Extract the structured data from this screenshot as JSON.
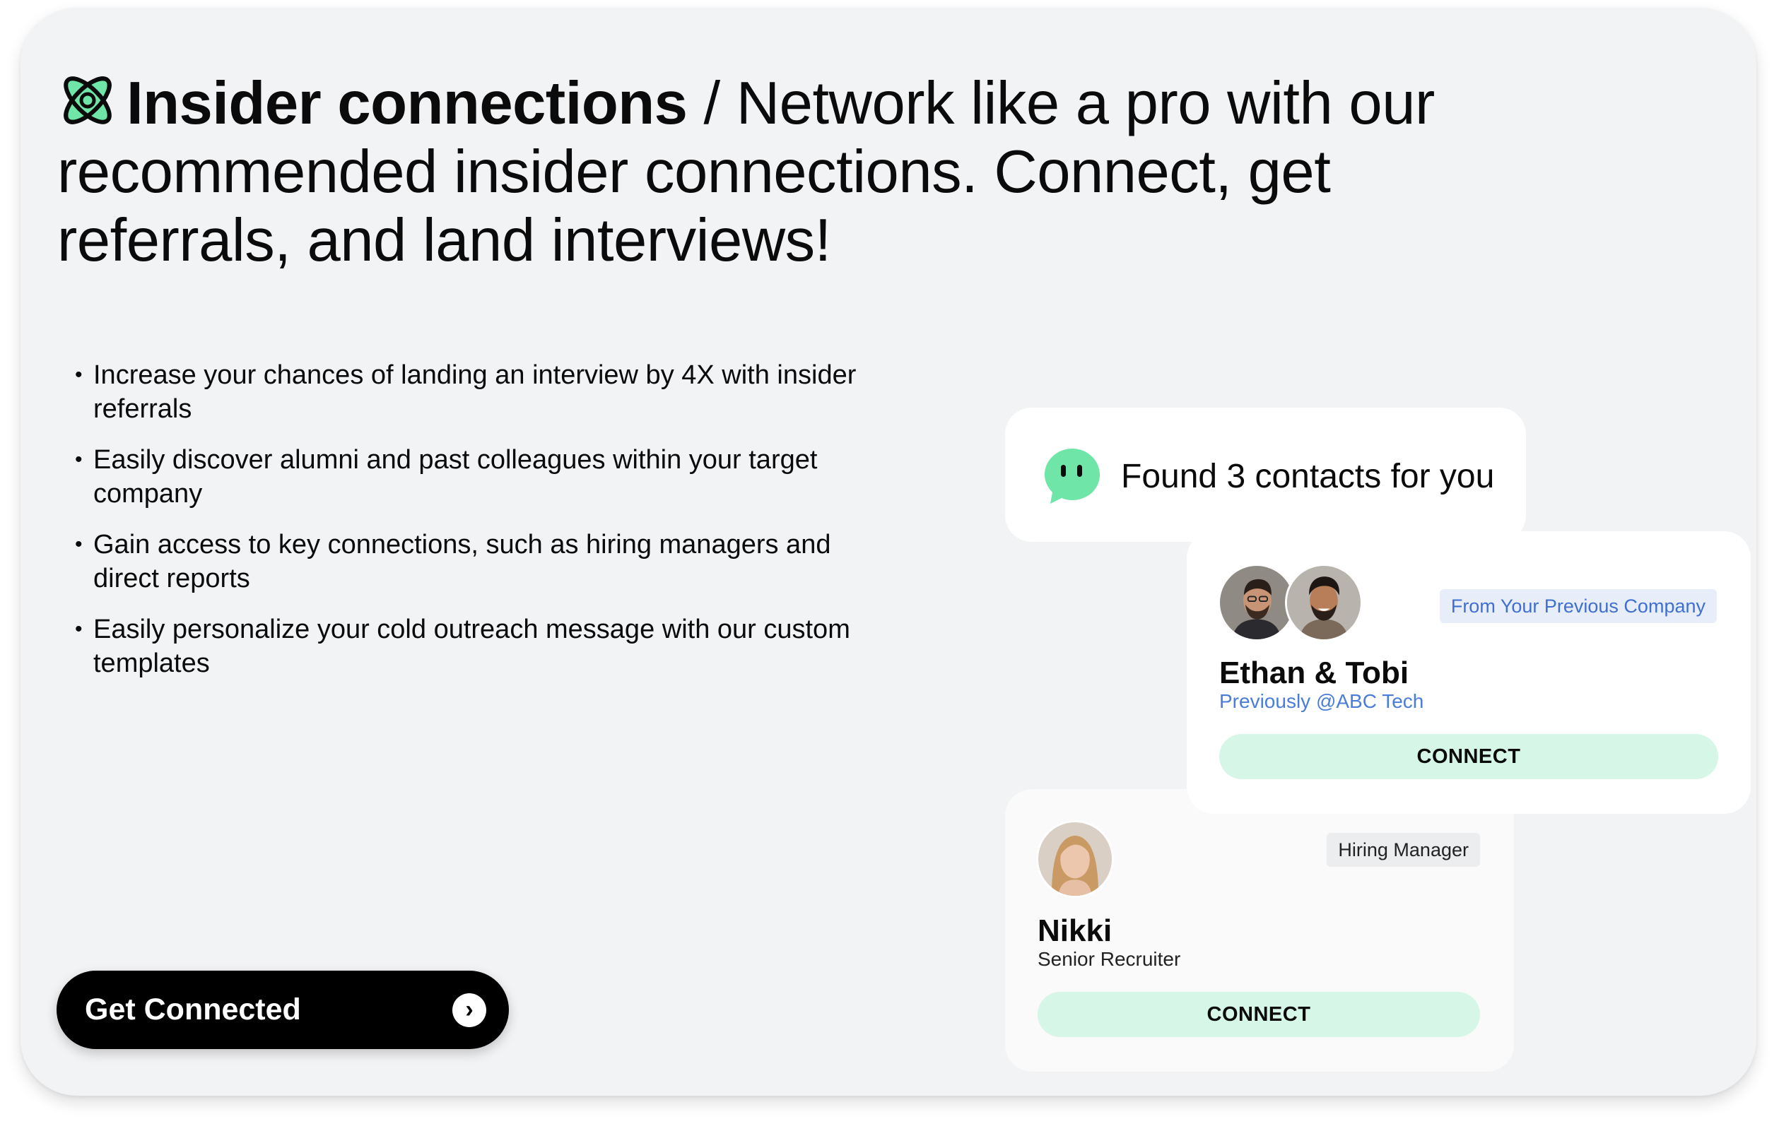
{
  "header": {
    "logo_icon": "atom-icon",
    "title_bold": "Insider connections",
    "title_rest": " / Network like a pro with our recommended insider connections. Connect, get referrals, and land interviews!"
  },
  "bullets": [
    "Increase your chances of landing an interview by 4X with insider referrals",
    "Easily discover alumni and past colleagues within your target company",
    "Gain access to key connections, such as hiring managers and direct reports",
    "Easily personalize your cold outreach message with our custom templates"
  ],
  "bullet_glyph": "•",
  "cta": {
    "label": "Get Connected",
    "arrow": "›"
  },
  "found": {
    "icon": "chat-bot-icon",
    "text": "Found 3 contacts for you"
  },
  "contacts": [
    {
      "badge": "From Your Previous Company",
      "name": "Ethan & Tobi",
      "subtitle": "Previously @ABC Tech",
      "button": "CONNECT"
    },
    {
      "badge": "Hiring Manager",
      "name": "Nikki",
      "subtitle": "Senior Recruiter",
      "button": "CONNECT"
    }
  ],
  "colors": {
    "accent_green": "#6fe6a8",
    "connect_bg": "#d6f6e7",
    "link_blue": "#4a7ddb",
    "card_bg": "#f2f3f5"
  }
}
